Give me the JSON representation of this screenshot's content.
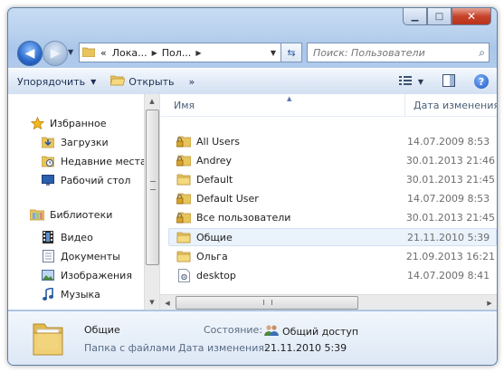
{
  "window": {
    "minimize_glyph": "▁",
    "maximize_glyph": "□",
    "close_glyph": "✕"
  },
  "address_bar": {
    "prefix": "«",
    "crumbs": [
      "Лока...",
      "Пол..."
    ],
    "refresh_icon": "refresh-icon"
  },
  "search": {
    "placeholder": "Поиск: Пользователи"
  },
  "toolbar": {
    "organize_label": "Упорядочить",
    "open_label": "Открыть",
    "more_label": "»"
  },
  "nav_pane": {
    "favorites_header": "Избранное",
    "favorites": [
      "Загрузки",
      "Недавние места",
      "Рабочий стол"
    ],
    "libraries_header": "Библиотеки",
    "libraries": [
      "Видео",
      "Документы",
      "Изображения",
      "Музыка"
    ]
  },
  "columns": {
    "name": "Имя",
    "date": "Дата изменения"
  },
  "files": [
    {
      "name": "All Users",
      "date": "14.07.2009 8:53",
      "icon": "locked-folder-icon"
    },
    {
      "name": "Andrey",
      "date": "30.01.2013 21:46",
      "icon": "locked-folder-icon"
    },
    {
      "name": "Default",
      "date": "30.01.2013 21:45",
      "icon": "folder-icon"
    },
    {
      "name": "Default User",
      "date": "14.07.2009 8:53",
      "icon": "locked-folder-icon"
    },
    {
      "name": "Все пользователи",
      "date": "30.01.2013 21:45",
      "icon": "locked-folder-icon"
    },
    {
      "name": "Общие",
      "date": "21.11.2010 5:39",
      "icon": "folder-icon",
      "selected": true
    },
    {
      "name": "Ольга",
      "date": "21.09.2013 16:21",
      "icon": "folder-icon"
    },
    {
      "name": "desktop",
      "date": "14.07.2009 8:41",
      "icon": "settings-file-icon"
    }
  ],
  "details": {
    "name": "Общие",
    "type": "Папка с файлами",
    "state_label": "Состояние:",
    "state_value": "Общий доступ",
    "modified_label": "Дата изменения:",
    "modified_value": "21.11.2010 5:39"
  },
  "colors": {
    "folder": "#e8c45c",
    "selection": "#eaf2fb",
    "accent": "#1c56b8"
  }
}
